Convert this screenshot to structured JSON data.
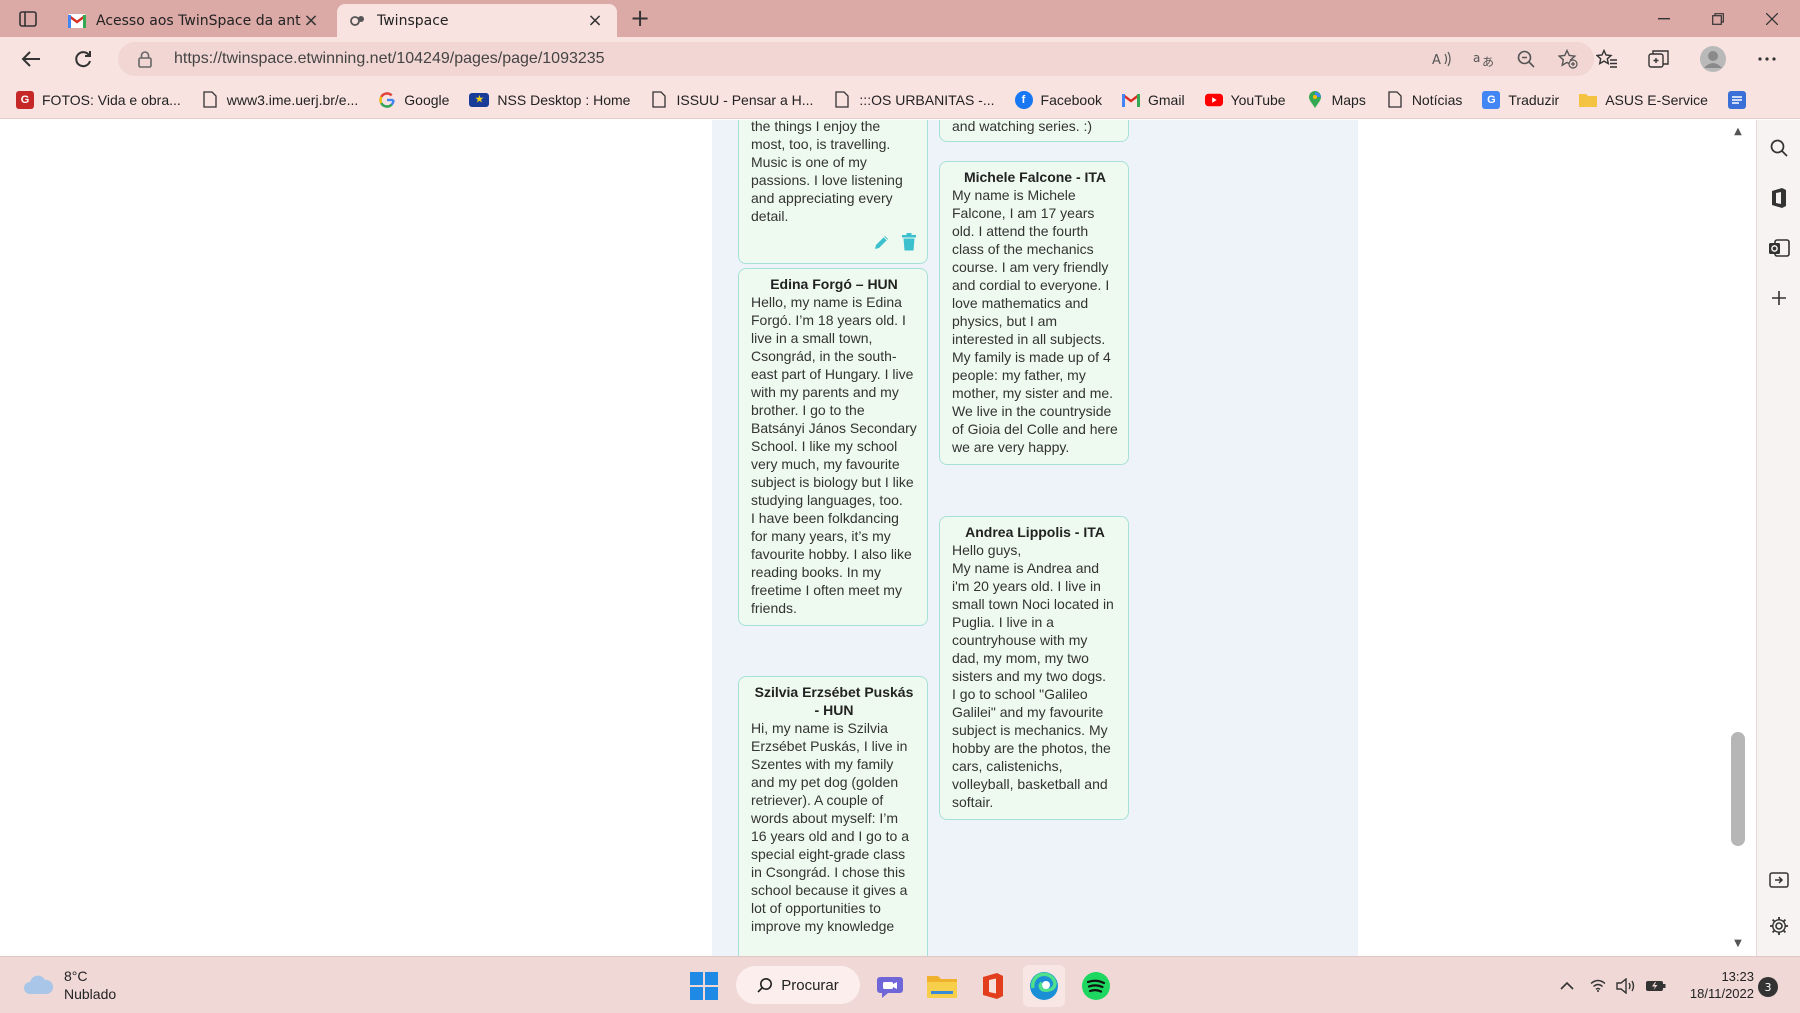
{
  "tabs": [
    {
      "title": "Acesso aos TwinSpace da antiga",
      "icon": "gmail-icon",
      "active": false
    },
    {
      "title": "Twinspace",
      "icon": "twinspace-icon",
      "active": true
    }
  ],
  "address": {
    "url": "https://twinspace.etwinning.net/104249/pages/page/1093235"
  },
  "bookmarks": [
    {
      "label": "FOTOS: Vida e obra...",
      "icon": "G"
    },
    {
      "label": "www3.ime.uerj.br/e...",
      "icon": "page"
    },
    {
      "label": "Google",
      "icon": "google"
    },
    {
      "label": "NSS Desktop : Home",
      "icon": "eu"
    },
    {
      "label": "ISSUU - Pensar a H...",
      "icon": "page"
    },
    {
      "label": ":::OS URBANITAS -...",
      "icon": "page"
    },
    {
      "label": "Facebook",
      "icon": "facebook"
    },
    {
      "label": "Gmail",
      "icon": "gmail"
    },
    {
      "label": "YouTube",
      "icon": "youtube"
    },
    {
      "label": "Maps",
      "icon": "maps"
    },
    {
      "label": "Notícias",
      "icon": "page"
    },
    {
      "label": "Traduzir",
      "icon": "translate"
    },
    {
      "label": "ASUS E-Service",
      "icon": "folder"
    }
  ],
  "cards": {
    "c1": {
      "title": "",
      "body": "the things I enjoy the most, too, is travelling. Music is one of my passions. I love listening and appreciating every detail."
    },
    "c2": {
      "title": "",
      "body": "and watching series. :)"
    },
    "c3": {
      "title": "Edina Forgó – HUN",
      "body": "Hello, my name is Edina Forgó. I’m 18 years old. I live in a small town, Csongrád, in the south-east part of Hungary. I live with my parents and my brother. I go to the Batsányi János Secondary School. I like my school very much, my favourite subject is biology but I like studying languages, too.\nI have been folkdancing for many years, it’s my favourite hobby. I also like reading books. In my freetime I often meet my friends."
    },
    "c4": {
      "title": "Michele Falcone - ITA",
      "body": "My name is Michele Falcone, I am 17 years old. I attend the fourth class of the mechanics course. I am very friendly and cordial to everyone. I love mathematics and physics, but I am interested in all subjects. My family is made up of 4 people: my father, my mother, my sister and me. We live in the countryside of Gioia del Colle and here we are very happy."
    },
    "c5": {
      "title": "Andrea Lippolis - ITA",
      "body": "Hello guys,\nMy name is Andrea and i'm 20 years old. I live in small town Noci located in Puglia. I live in a countryhouse with my dad, my mom, my two sisters and my two dogs.\nI go to school \"Galileo Galilei\" and my favourite subject is mechanics. My hobby are the photos, the cars, calistenichs, volleyball, basketball and softair."
    },
    "c6": {
      "title": "Szilvia Erzsébet Puskás - HUN",
      "body": "Hi, my name is Szilvia Erzsébet Puskás, I live in Szentes with my family and my pet dog (golden retriever). A couple of words about myself: I’m 16 years old and I go to a special eight-grade class in Csongrád. I chose this school because it gives a lot of opportunities to improve my knowledge"
    }
  },
  "taskbar": {
    "weather_temp": "8°C",
    "weather_desc": "Nublado",
    "search_label": "Procurar",
    "time": "13:23",
    "date": "18/11/2022",
    "notifications": "3"
  },
  "colors": {
    "accent": "#1bb3c8",
    "card_border": "#a7e0d7",
    "card_bg": "#eefaef",
    "panel_bg": "#edf3f9"
  }
}
